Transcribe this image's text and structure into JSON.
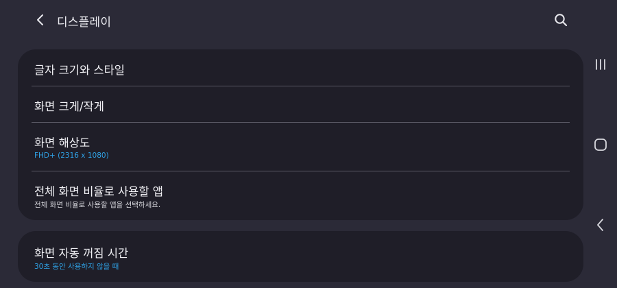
{
  "header": {
    "title": "디스플레이",
    "back_icon": "chevron-left-icon",
    "search_icon": "search-icon"
  },
  "settings": {
    "group1": [
      {
        "label": "글자 크기와 스타일"
      },
      {
        "label": "화면 크게/작게"
      },
      {
        "label": "화면 해상도",
        "sub": "FHD+ (2316 x 1080)"
      },
      {
        "label": "전체 화면 비율로 사용할 앱",
        "sub": "전체 화면 비율로 사용할 앱을 선택하세요."
      }
    ],
    "group2": [
      {
        "label": "화면 자동 꺼짐 시간",
        "sub": "30초 동안 사용하지 않을 때"
      }
    ]
  },
  "navbar": {
    "recents_icon": "recents-icon",
    "home_icon": "home-icon",
    "back_icon": "back-nav-icon"
  },
  "colors": {
    "background": "#2b2a37",
    "card": "#1f1e28",
    "accent": "#2fa2e6",
    "divider": "#5a5965"
  }
}
